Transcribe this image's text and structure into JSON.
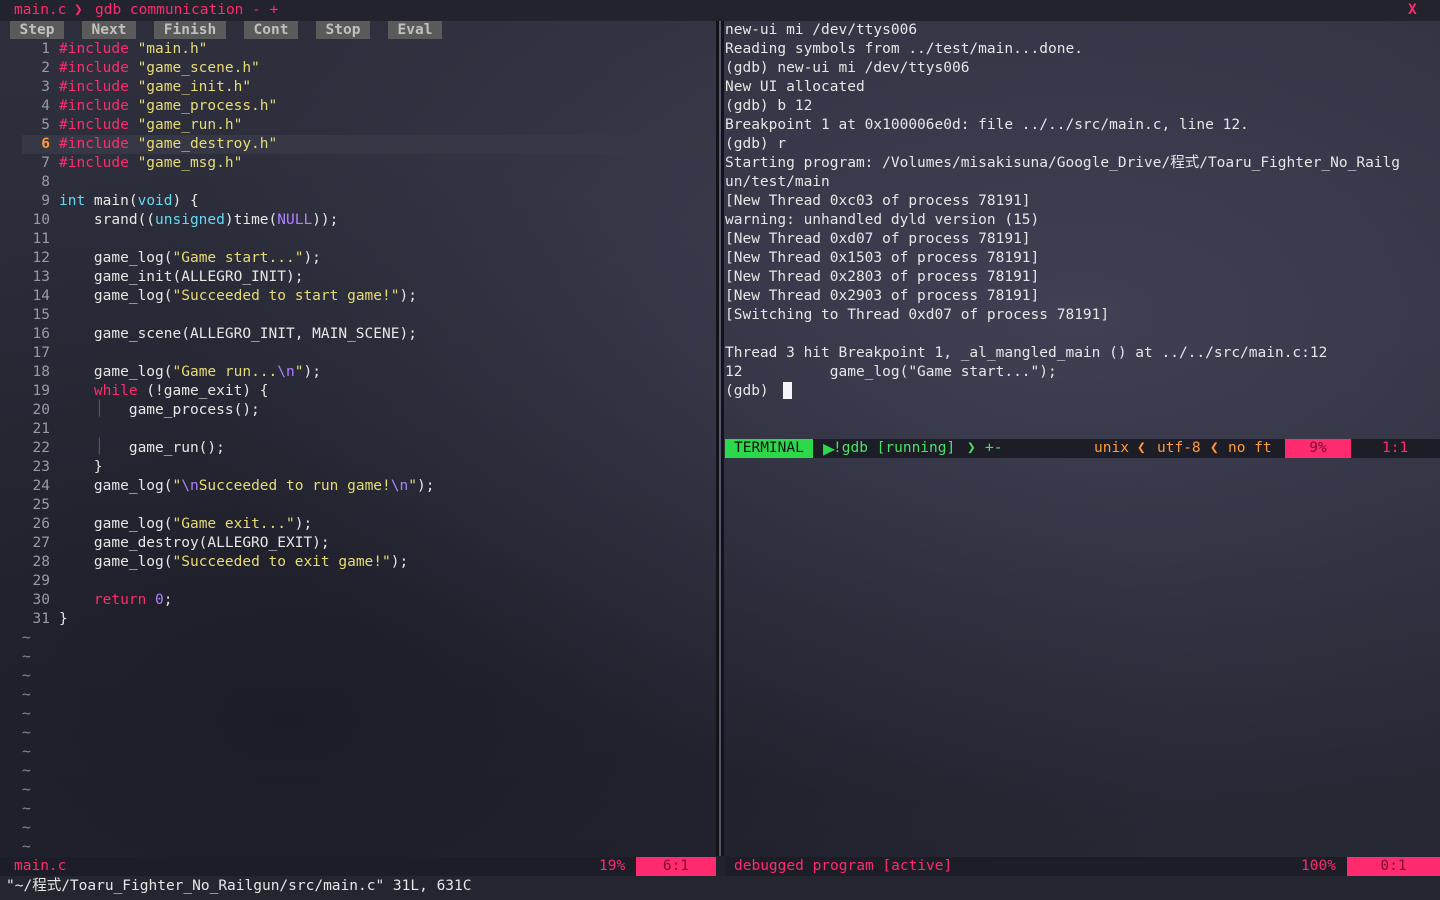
{
  "tabline": {
    "tab1": "main.c",
    "tab2": "gdb communication - +",
    "close": "X"
  },
  "winbar": [
    "Step",
    "Next",
    "Finish",
    "Cont",
    "Stop",
    "Eval"
  ],
  "editor": {
    "lines": [
      {
        "n": "1",
        "parts": [
          [
            "kw",
            "#include"
          ],
          [
            "",
            ""
          ],
          [
            "str",
            " \"main.h\""
          ]
        ]
      },
      {
        "n": "2",
        "parts": [
          [
            "kw",
            "#include"
          ],
          [
            "str",
            " \"game_scene.h\""
          ]
        ]
      },
      {
        "n": "3",
        "parts": [
          [
            "kw",
            "#include"
          ],
          [
            "str",
            " \"game_init.h\""
          ]
        ]
      },
      {
        "n": "4",
        "parts": [
          [
            "kw",
            "#include"
          ],
          [
            "str",
            " \"game_process.h\""
          ]
        ]
      },
      {
        "n": "5",
        "parts": [
          [
            "kw",
            "#include"
          ],
          [
            "str",
            " \"game_run.h\""
          ]
        ]
      },
      {
        "n": "6",
        "parts": [
          [
            "kw",
            "#include"
          ],
          [
            "str",
            " \"game_destroy.h\""
          ]
        ]
      },
      {
        "n": "7",
        "parts": [
          [
            "kw",
            "#include"
          ],
          [
            "str",
            " \"game_msg.h\""
          ]
        ]
      },
      {
        "n": "8",
        "parts": []
      },
      {
        "n": "9",
        "parts": [
          [
            "ty",
            "int"
          ],
          [
            "",
            " main("
          ],
          [
            "ty",
            "void"
          ],
          [
            "",
            ") {"
          ]
        ]
      },
      {
        "n": "10",
        "parts": [
          [
            "",
            "    srand(("
          ],
          [
            "ty",
            "unsigned"
          ],
          [
            "",
            ")time("
          ],
          [
            "esc",
            "NULL"
          ],
          [
            "",
            "));"
          ]
        ]
      },
      {
        "n": "11",
        "parts": []
      },
      {
        "n": "12",
        "parts": [
          [
            "",
            "    game_log("
          ],
          [
            "str",
            "\"Game start...\""
          ],
          [
            "",
            ");"
          ]
        ]
      },
      {
        "n": "13",
        "parts": [
          [
            "",
            "    game_init(ALLEGRO_INIT);"
          ]
        ]
      },
      {
        "n": "14",
        "parts": [
          [
            "",
            "    game_log("
          ],
          [
            "str",
            "\"Succeeded to start game!\""
          ],
          [
            "",
            ");"
          ]
        ]
      },
      {
        "n": "15",
        "parts": []
      },
      {
        "n": "16",
        "parts": [
          [
            "",
            "    game_scene(ALLEGRO_INIT, MAIN_SCENE);"
          ]
        ]
      },
      {
        "n": "17",
        "parts": []
      },
      {
        "n": "18",
        "parts": [
          [
            "",
            "    game_log("
          ],
          [
            "str",
            "\"Game run..."
          ],
          [
            "esc",
            "\\n"
          ],
          [
            "str",
            "\""
          ],
          [
            "",
            ");"
          ]
        ]
      },
      {
        "n": "19",
        "parts": [
          [
            "kw",
            "    while"
          ],
          [
            "",
            " (!game_exit) {"
          ]
        ]
      },
      {
        "n": "20",
        "parts": [
          [
            "",
            "        game_process();"
          ]
        ]
      },
      {
        "n": "21",
        "parts": []
      },
      {
        "n": "22",
        "parts": [
          [
            "",
            "        game_run();"
          ]
        ]
      },
      {
        "n": "23",
        "parts": [
          [
            "",
            "    }"
          ]
        ]
      },
      {
        "n": "24",
        "parts": [
          [
            "",
            "    game_log("
          ],
          [
            "str",
            "\""
          ],
          [
            "esc",
            "\\n"
          ],
          [
            "str",
            "Succeeded to run game!"
          ],
          [
            "esc",
            "\\n"
          ],
          [
            "str",
            "\""
          ],
          [
            "",
            ");"
          ]
        ]
      },
      {
        "n": "25",
        "parts": []
      },
      {
        "n": "26",
        "parts": [
          [
            "",
            "    game_log("
          ],
          [
            "str",
            "\"Game exit...\""
          ],
          [
            "",
            ");"
          ]
        ]
      },
      {
        "n": "27",
        "parts": [
          [
            "",
            "    game_destroy(ALLEGRO_EXIT);"
          ]
        ]
      },
      {
        "n": "28",
        "parts": [
          [
            "",
            "    game_log("
          ],
          [
            "str",
            "\"Succeeded to exit game!\""
          ],
          [
            "",
            ");"
          ]
        ]
      },
      {
        "n": "29",
        "parts": []
      },
      {
        "n": "30",
        "parts": [
          [
            "kw",
            "    return"
          ],
          [
            "",
            " "
          ],
          [
            "num",
            "0"
          ],
          [
            "",
            ";"
          ]
        ]
      },
      {
        "n": "31",
        "parts": [
          [
            "",
            "}"
          ]
        ]
      }
    ],
    "current_line": "6",
    "tilde": "~"
  },
  "terminal": {
    "lines": [
      "new-ui mi /dev/ttys006",
      "Reading symbols from ../test/main...done.",
      "(gdb) new-ui mi /dev/ttys006",
      "New UI allocated",
      "(gdb) b 12",
      "Breakpoint 1 at 0x100006e0d: file ../../src/main.c, line 12.",
      "(gdb) r",
      "Starting program: /Volumes/misakisuna/Google_Drive/程式/Toaru_Fighter_No_Railg",
      "un/test/main",
      "[New Thread 0xc03 of process 78191]",
      "warning: unhandled dyld version (15)",
      "[New Thread 0xd07 of process 78191]",
      "[New Thread 0x1503 of process 78191]",
      "[New Thread 0x2803 of process 78191]",
      "[New Thread 0x2903 of process 78191]",
      "[Switching to Thread 0xd07 of process 78191]",
      "",
      "Thread 3 hit Breakpoint 1, _al_mangled_main () at ../../src/main.c:12",
      "12          game_log(\"Game start...\");",
      "(gdb) "
    ]
  },
  "terminal_status": {
    "mode": "TERMINAL",
    "name": "!gdb [running]",
    "modified": "+-",
    "format": "unix",
    "encoding": "utf-8",
    "filetype": "no ft",
    "percent": "9%",
    "position": "1:1"
  },
  "left_status": {
    "file": "main.c",
    "percent": "19%",
    "position": "6:1"
  },
  "right_status": {
    "name": "debugged program [active]",
    "percent": "100%",
    "position": "0:1"
  },
  "cmdline": "\"~/程式/Toaru_Fighter_No_Railgun/src/main.c\" 31L, 631C"
}
